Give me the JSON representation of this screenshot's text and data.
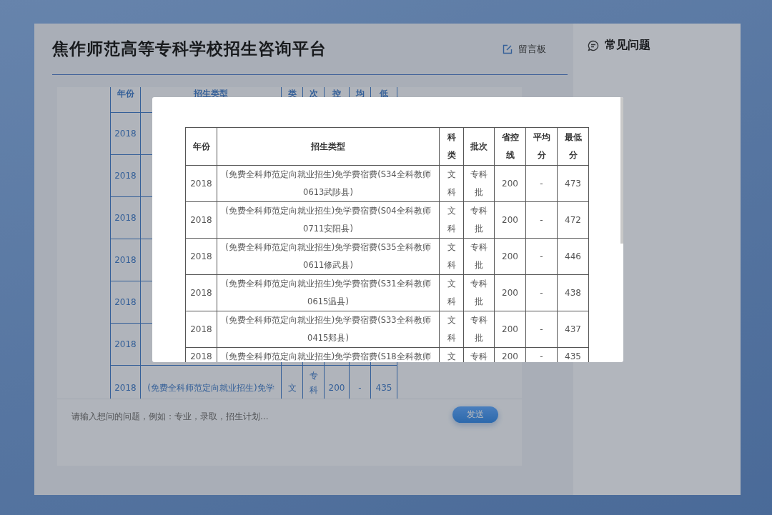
{
  "header": {
    "title": "焦作师范高等专科学校招生咨询平台",
    "message_board": "留言板"
  },
  "sidebar": {
    "title": "常见问题"
  },
  "chat_table": {
    "columns": [
      "年份",
      "招生类型",
      "类",
      "次",
      "控",
      "均",
      "低"
    ],
    "rows": [
      {
        "year": "2018"
      },
      {
        "year": "2018"
      },
      {
        "year": "2018"
      },
      {
        "year": "2018"
      },
      {
        "year": "2018"
      },
      {
        "year": "2018"
      },
      {
        "year": "2018",
        "type": "(免费全科师范定向就业招生)免学",
        "subject": "文",
        "batch": "专科",
        "control": "200",
        "average": "-",
        "minimum": "435"
      }
    ]
  },
  "composer": {
    "placeholder": "请输入想问的问题，例如：专业，录取，招生计划...",
    "send": "发送"
  },
  "modal": {
    "columns": [
      "年份",
      "招生类型",
      "科类",
      "批次",
      "省控线",
      "平均分",
      "最低分"
    ],
    "rows": [
      {
        "year": "2018",
        "type_lines": [
          "(免费全科师范定向就业招生)免学费宿费(S34全科教师",
          "0613武陟县)"
        ],
        "subject": "文科",
        "batch": "专科批",
        "control": "200",
        "average": "-",
        "minimum": "473"
      },
      {
        "year": "2018",
        "type_lines": [
          "(免费全科师范定向就业招生)免学费宿费(S04全科教师",
          "0711安阳县)"
        ],
        "subject": "文科",
        "batch": "专科批",
        "control": "200",
        "average": "-",
        "minimum": "472"
      },
      {
        "year": "2018",
        "type_lines": [
          "(免费全科师范定向就业招生)免学费宿费(S35全科教师",
          "0611修武县)"
        ],
        "subject": "文科",
        "batch": "专科批",
        "control": "200",
        "average": "-",
        "minimum": "446"
      },
      {
        "year": "2018",
        "type_lines": [
          "(免费全科师范定向就业招生)免学费宿费(S31全科教师",
          "0615温县)"
        ],
        "subject": "文科",
        "batch": "专科批",
        "control": "200",
        "average": "-",
        "minimum": "438"
      },
      {
        "year": "2018",
        "type_lines": [
          "(免费全科师范定向就业招生)免学费宿费(S33全科教师",
          "0415郏县)"
        ],
        "subject": "文科",
        "batch": "专科批",
        "control": "200",
        "average": "-",
        "minimum": "437"
      },
      {
        "year": "2018",
        "type_lines": [
          "(免费全科师范定向就业招生)免学费宿费(S18全科教师"
        ],
        "subject": "文",
        "batch": "专科",
        "control": "200",
        "average": "-",
        "minimum": "435"
      }
    ]
  }
}
